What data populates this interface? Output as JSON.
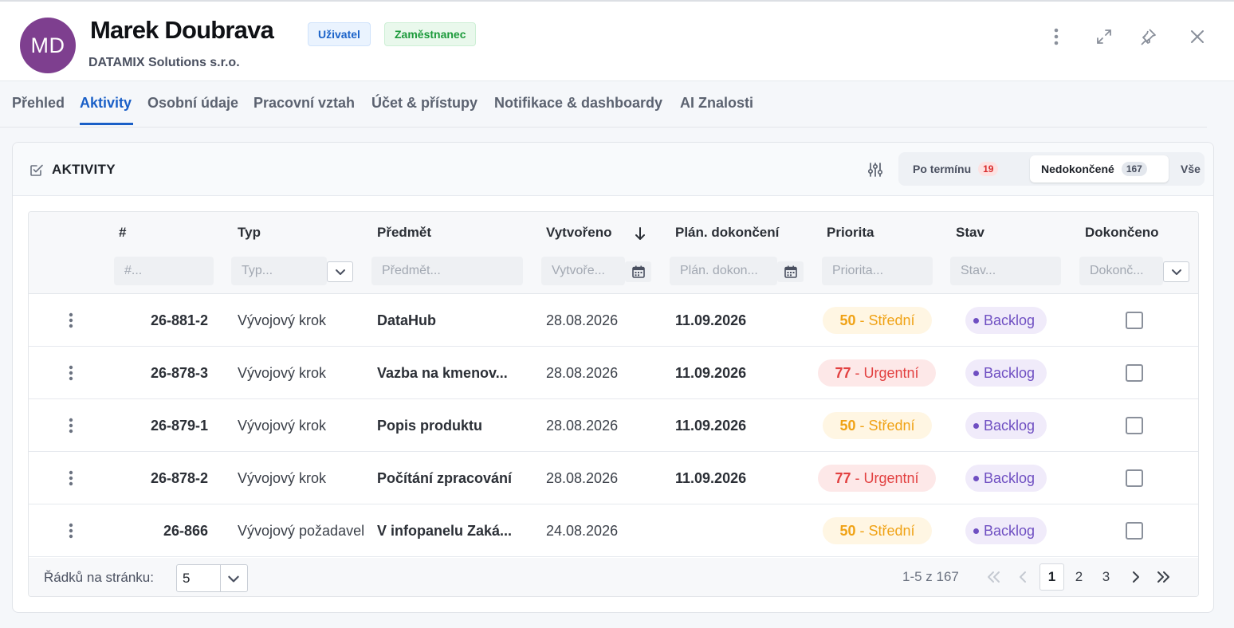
{
  "profile": {
    "initials": "MD",
    "name": "Marek Doubrava",
    "company": "DATAMIX Solutions s.r.o.",
    "badges": [
      "Uživatel",
      "Zaměstnanec"
    ],
    "avatar_color": "#7e3f8f"
  },
  "header_icons": [
    "more-vertical-icon",
    "expand-icon",
    "pin-icon",
    "close-icon"
  ],
  "tabs": [
    "Přehled",
    "Aktivity",
    "Osobní údaje",
    "Pracovní vztah",
    "Účet & přístupy",
    "Notifikace & dashboardy",
    "AI Znalosti"
  ],
  "active_tab": "Aktivity",
  "card": {
    "title": "AKTIVITY",
    "segments": [
      {
        "label": "Po termínu",
        "count": "19"
      },
      {
        "label": "Nedokončené",
        "count": "167"
      },
      {
        "label": "Vše",
        "count": null
      }
    ],
    "active_segment": "Nedokončené"
  },
  "table": {
    "columns": [
      "#",
      "Typ",
      "Předmět",
      "Vytvořeno",
      "Plán. dokončení",
      "Priorita",
      "Stav",
      "Dokončeno"
    ],
    "sorted_column": "Vytvořeno",
    "sort_direction": "desc",
    "filter_placeholders": [
      "#...",
      "Typ...",
      "Předmět...",
      "Vytvoře...",
      "Plán. dokon...",
      "Priorita...",
      "Stav...",
      "Dokonč..."
    ],
    "rows": [
      {
        "id": "26-881-2",
        "type": "Vývojový krok",
        "subject": "DataHub",
        "created": "28.08.2026",
        "planned": "11.09.2026",
        "priority_num": "50",
        "priority_label": " - Střední",
        "priority_level": "mid",
        "state": "Backlog",
        "done": false
      },
      {
        "id": "26-878-3",
        "type": "Vývojový krok",
        "subject": "Vazba na kmenov...",
        "created": "28.08.2026",
        "planned": "11.09.2026",
        "priority_num": "77",
        "priority_label": " - Urgentní",
        "priority_level": "urgent",
        "state": "Backlog",
        "done": false
      },
      {
        "id": "26-879-1",
        "type": "Vývojový krok",
        "subject": "Popis produktu",
        "created": "28.08.2026",
        "planned": "11.09.2026",
        "priority_num": "50",
        "priority_label": " - Střední",
        "priority_level": "mid",
        "state": "Backlog",
        "done": false
      },
      {
        "id": "26-878-2",
        "type": "Vývojový krok",
        "subject": "Počítání zpracování",
        "created": "28.08.2026",
        "planned": "11.09.2026",
        "priority_num": "77",
        "priority_label": " - Urgentní",
        "priority_level": "urgent",
        "state": "Backlog",
        "done": false
      },
      {
        "id": "26-866",
        "type": "Vývojový požadavel",
        "subject": "V infopanelu Zaká...",
        "created": "24.08.2026",
        "planned": "",
        "priority_num": "50",
        "priority_label": " - Střední",
        "priority_level": "mid",
        "state": "Backlog",
        "done": false
      }
    ]
  },
  "pagination": {
    "rows_per_page_label": "Řádků na stránku:",
    "rows_per_page": "5",
    "range": "1-5 z 167",
    "pages": [
      "1",
      "2",
      "3"
    ],
    "current_page": "1"
  },
  "colors": {
    "accent": "#1a5fc7",
    "priority_mid": "#f0a215",
    "priority_urgent": "#e24040",
    "state": "#6f4fc2"
  }
}
